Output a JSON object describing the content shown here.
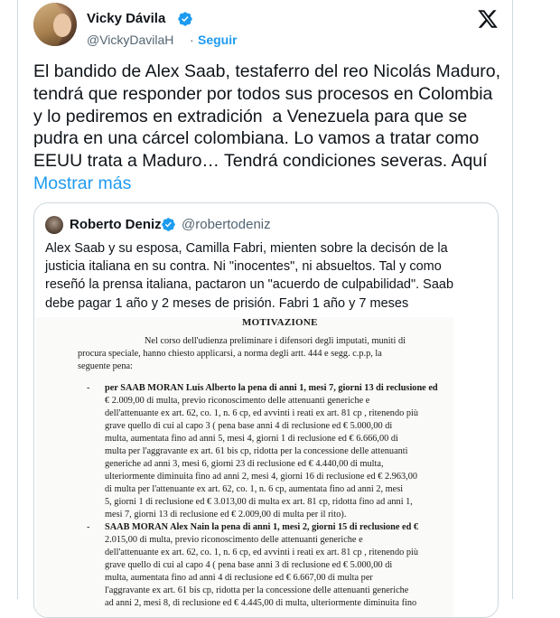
{
  "author": {
    "name": "Vicky Dávila",
    "handle": "@VickyDavilaH",
    "separator": "·",
    "follow_label": "Seguir"
  },
  "icons": {
    "verified": "verified-badge-icon",
    "x_logo": "x-logo-icon"
  },
  "colors": {
    "accent": "#1d9bf0",
    "text": "#0f1419",
    "muted": "#536471",
    "border": "#cfd9de"
  },
  "tweet": {
    "text": "El bandido de Alex Saab, testaferro del reo Nicolás Maduro, tendrá que responder por todos sus procesos en Colombia y lo pediremos en extradición  a Venezuela para que se pudra en una cárcel colombiana. Lo vamos a tratar como EEUU trata a Maduro… Tendrá condiciones severas. Aquí ",
    "show_more": "Mostrar más"
  },
  "quote": {
    "name": "Roberto Deniz",
    "handle": "@robertodeniz",
    "text": "Alex Saab y su esposa, Camilla Fabri, mienten sobre la decisón de la justicia italiana en su contra. Ni \"inocentes\", ni absueltos. Tal y como reseñó la prensa italiana, pactaron un \"acuerdo de culpabilidad\". Saab debe pagar 1 año y 2 meses de prisión. Fabri 1 año y 7 meses"
  },
  "document": {
    "title": "MOTIVAZIONE",
    "lines": [
      "Nel corso dell'udienza preliminare i difensori degli imputati, muniti di",
      "procura speciale, hanno chiesto applicarsi, a norma degli artt. 444 e segg. c.p.p, la",
      "seguente pena:",
      "per SAAB MORAN Luis Alberto la pena di anni 1, mesi 7, giorni 13 di reclusione ed",
      "€ 2.009,00 di multa,   previo riconoscimento   delle attenuanti generiche e",
      "dell'attenuante ex art. 62, co. 1, n. 6 cp, ed avvinti i reati ex art. 81 cp , ritenendo più",
      "grave quello di cui al capo 3  (  pena base anni 4 di reclusione ed € 5.000,00 di",
      "multa,   aumentata   fino ad anni 5, mesi 4, giorni 1 di reclusione ed € 6.666,00 di",
      "multa per l'aggravante ex art. 61 bis cp,   ridotta per la concessione delle attenuanti",
      "generiche ad anni 3, mesi 6, giorni 23 di reclusione ed € 4.440,00 di multa,",
      "ulteriormente diminuita fino ad anni 2, mesi 4, giorni 16 di reclusione ed € 2.963,00",
      "di multa per l'attenuante  ex art. 62, co. 1, n. 6 cp,  aumentata fino ad anni 2, mesi",
      "5, giorni 1 di reclusione ed € 3.013,00 di multa ex art. 81 cp, ridotta fino ad  anni 1,",
      "mesi 7, giorni 13 di reclusione ed € 2.009,00 di multa per il rito).",
      "SAAB MORAN Alex Nain la pena di anni 1, mesi 2, giorni 15 di reclusione ed €",
      "2.015,00  di multa,       previo  riconoscimento    delle  attenuanti  generiche  e",
      "dell'attenuante ex art. 62, co. 1, n. 6 cp, ed avvinti i reati ex art. 81 cp , ritenendo più",
      "grave quello di cui al capo 4  (  pena base anni 3 di reclusione ed € 5.000,00 di",
      "multa,   aumentata   fino ad anni 4 di reclusione ed € 6.667,00 di multa per",
      "l'aggravante ex art. 61 bis cp,   ridotta per la concessione delle attenuanti generiche",
      "ad anni 2, mesi 8, di reclusione ed € 4.445,00 di multa, ulteriormente diminuita fino"
    ]
  }
}
